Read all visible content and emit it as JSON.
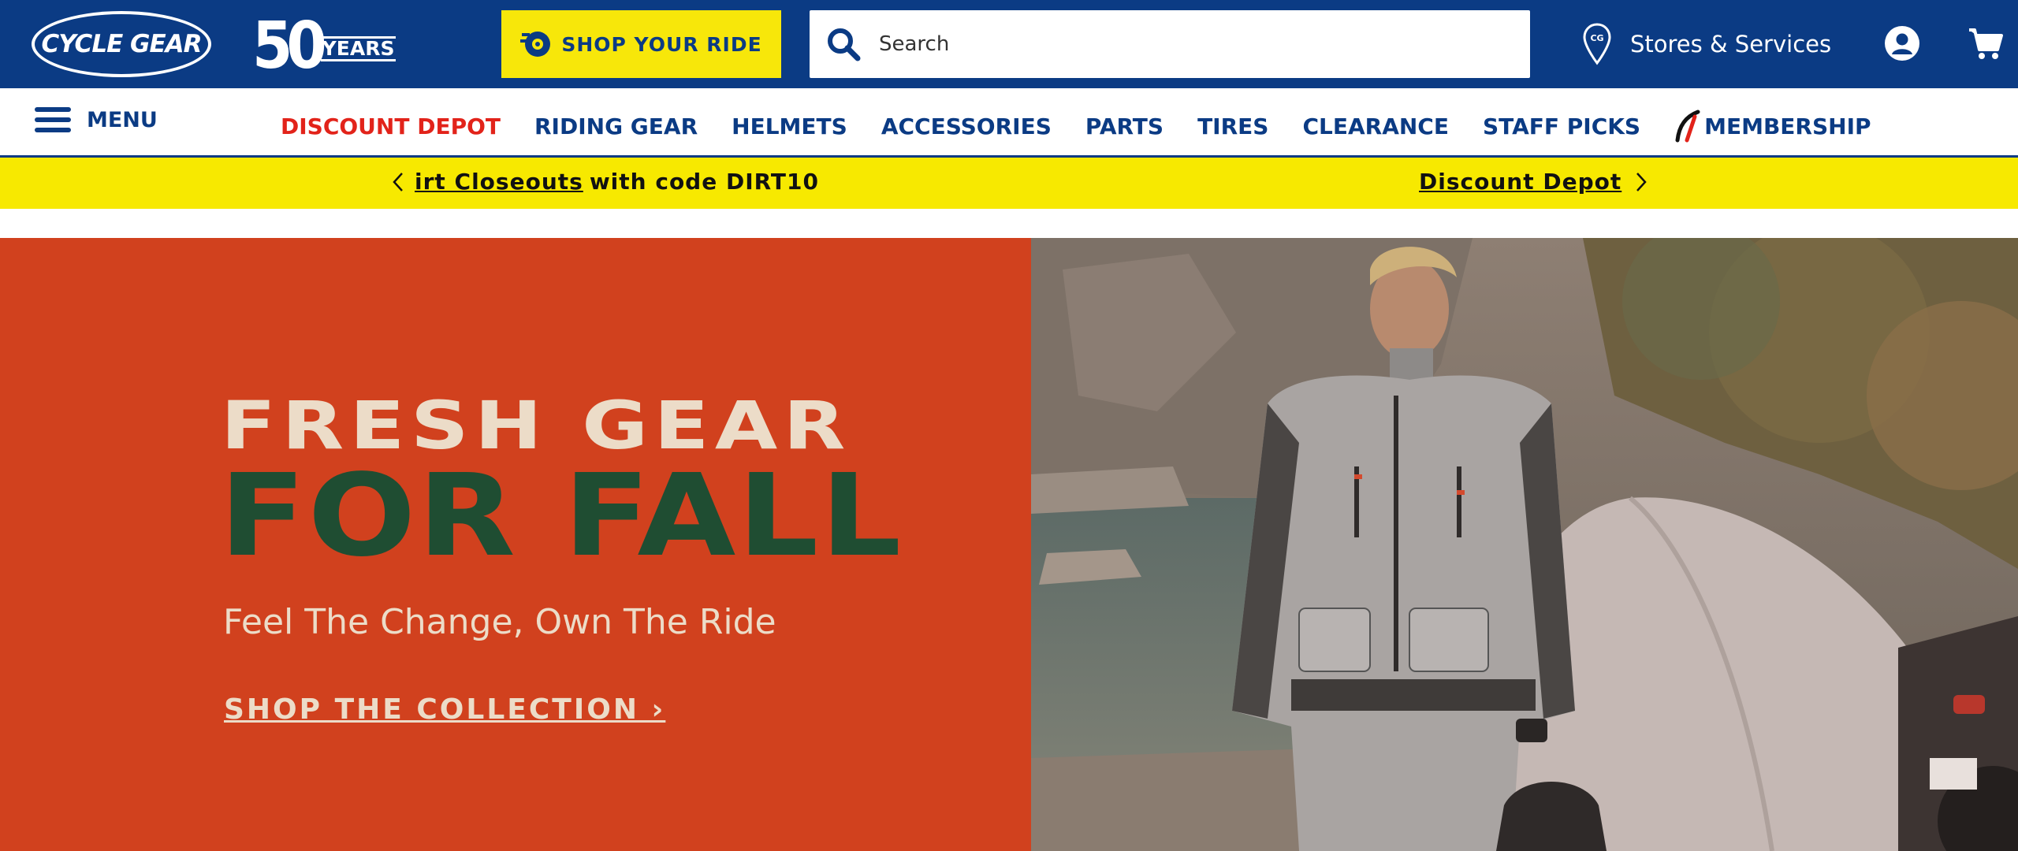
{
  "header": {
    "logo_text": "CYCLE GEAR",
    "anniversary_number": "50",
    "anniversary_label": "YEARS",
    "shop_ride_label": "SHOP YOUR RIDE",
    "search_placeholder": "Search",
    "stores_label": "Stores & Services",
    "colors": {
      "primary": "#0b3b84",
      "accent": "#f7e70a"
    },
    "icons": [
      "tire-icon",
      "search-icon",
      "location-pin-icon",
      "account-icon",
      "cart-icon"
    ]
  },
  "nav": {
    "menu_label": "MENU",
    "links": [
      "DISCOUNT DEPOT",
      "RIDING GEAR",
      "HELMETS",
      "ACCESSORIES",
      "PARTS",
      "TIRES",
      "CLEARANCE",
      "STAFF PICKS"
    ],
    "membership_label": "MEMBERSHIP",
    "highlight_color": "#e2231a"
  },
  "promo": {
    "left_link": "irt Closeouts",
    "left_text": "with code DIRT10",
    "right_link": "Discount Depot"
  },
  "hero": {
    "headline_top": "FRESH GEAR",
    "headline_bottom": "FOR FALL",
    "subheadline": "Feel The Change, Own The Ride",
    "cta": "SHOP THE COLLECTION ›",
    "background_color": "#d1411e"
  }
}
